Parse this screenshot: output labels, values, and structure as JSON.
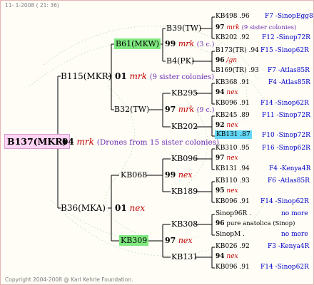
{
  "header": {
    "text": "11- 1-2008 ( 21: 36)"
  },
  "footer": {
    "text": "Copyright 2004-2008 @ Karl Kehrle Foundation."
  },
  "root": {
    "name": "B137(MKR)",
    "num": "04",
    "tag": "mrk",
    "note": "(Drones from 15 sister colonies)"
  },
  "sire": {
    "name": "B115(MKR)",
    "num": "01",
    "tag": "mrk",
    "note": "(9 sister colonies)"
  },
  "dam": {
    "name": "B36(MKA)",
    "num": "01",
    "tag": "nex"
  },
  "b61": {
    "name": "B61(MKW)",
    "num": "99",
    "tag": "mrk",
    "note": "(3 c.)"
  },
  "b32": {
    "name": "B32(TW)",
    "num": "97",
    "tag": "mrk",
    "note": "(9 c.)"
  },
  "kb068": {
    "name": "KB068",
    "num": "99",
    "tag": "nex"
  },
  "kb309": {
    "name": "KB309",
    "num": "97",
    "tag": "nex"
  },
  "g3": {
    "b39": "B39(TW)",
    "b4": "B4(PK)",
    "kb295": "KB295",
    "kb202": "KB202",
    "kb096": "KB096",
    "kb189": "KB189",
    "kb308": "KB308",
    "kb131": "KB131"
  },
  "g4": [
    {
      "text": "KB498 .96",
      "right": "F7 -SinopEgg86R"
    },
    {
      "text": "97",
      "tag": "mrk",
      "note": "(9 sister colonies)"
    },
    {
      "text": "KB202 .92",
      "right": "F12 -Sinop72R"
    },
    {
      "text": "B173(TR) .94",
      "right": "F15 -Sinop62R"
    },
    {
      "text": "96",
      "tag": "/gn"
    },
    {
      "text": "B169(TR) .93",
      "right": "F7 -Atlas85R"
    },
    {
      "text": "KB368 .91",
      "right": "F4 -Atlas85R"
    },
    {
      "text": "94",
      "tag": "nex"
    },
    {
      "text": "KB096 .91",
      "right": "F14 -Sinop62R"
    },
    {
      "text": "KB245 .89",
      "right": "F11 -Sinop72R"
    },
    {
      "text": "92",
      "tag": "nex"
    },
    {
      "text": "KB131 .87",
      "right": "F10 -Sinop72R"
    },
    {
      "text": "KB310 .95",
      "right": "F16 -Sinop62R"
    },
    {
      "text": "97",
      "tag": "nex"
    },
    {
      "text": "KB131 .94",
      "right": "F4 -Kenya4R"
    },
    {
      "text": "KB110 .93",
      "right": "F6 -Atlas85R"
    },
    {
      "text": "95",
      "tag": "nex"
    },
    {
      "text": "KB096 .91",
      "right": "F14 -Sinop62R"
    },
    {
      "text": "Sinop96R .",
      "right": "no more"
    },
    {
      "text": "96",
      "note": "pure anatolica (Sinop)"
    },
    {
      "text": "SinopM .",
      "right": "no more"
    },
    {
      "text": "KB026 .92",
      "right": "F3 -Kenya4R"
    },
    {
      "text": "94",
      "tag": "nex"
    },
    {
      "text": "KB096 .91",
      "right": "F14 -Sinop62R"
    }
  ]
}
